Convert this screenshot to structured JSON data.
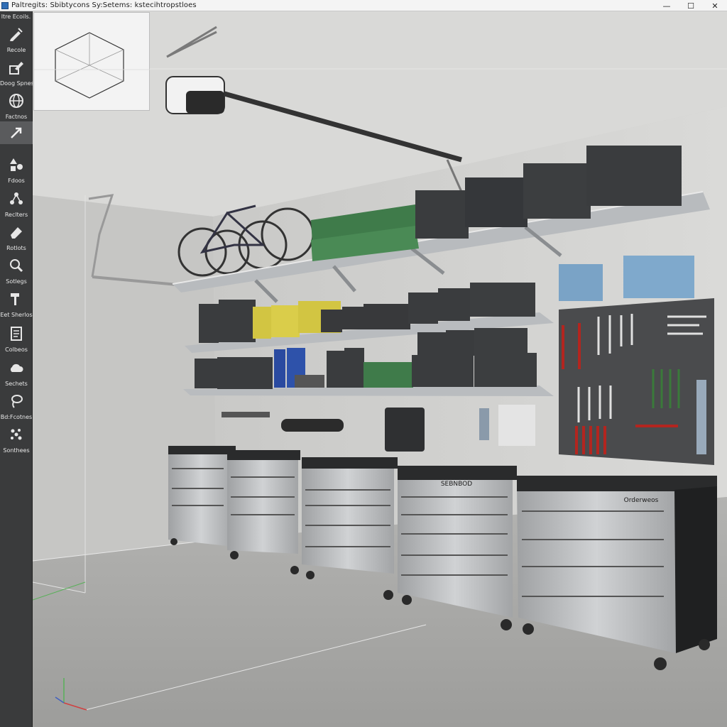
{
  "window": {
    "title": "Paltregits: Sbibtycons Sy:Setems: kstecihtropstloes",
    "minimize_glyph": "—",
    "maximize_glyph": "☐",
    "close_glyph": "✕"
  },
  "toolbar": {
    "header": "ltre Ecoils.",
    "tools": [
      {
        "label": "Recole",
        "icon": "pencil-ruler-icon"
      },
      {
        "label": "Doog Spnes",
        "icon": "pencil-box-icon"
      },
      {
        "label": "Factnos",
        "icon": "globe-icon"
      },
      {
        "label": "",
        "icon": "arrow-icon"
      },
      {
        "label": "Fdoos",
        "icon": "shapes-icon"
      },
      {
        "label": "Reclters",
        "icon": "nodes-icon"
      },
      {
        "label": "Rotlots",
        "icon": "eraser-icon"
      },
      {
        "label": "Sotlegs",
        "icon": "magnifier-icon"
      },
      {
        "label": "Eet Sherlos",
        "icon": "hammer-icon"
      },
      {
        "label": "Colbeos",
        "icon": "document-icon"
      },
      {
        "label": "Sechets",
        "icon": "cloud-icon"
      },
      {
        "label": "Bd:Fcotnes",
        "icon": "lasso-icon"
      },
      {
        "label": "Sonthees",
        "icon": "particles-icon"
      }
    ]
  },
  "scene": {
    "cabinet_brand_1": "SEBNBOD",
    "cabinet_brand_2": "Orderweos",
    "colors": {
      "wall": "#d2d2cf",
      "ceiling": "#dcdcda",
      "floor": "#a7a7a5",
      "shelf": "#b9bcbf",
      "bin_dark": "#3a3c3e",
      "bin_green": "#3f7b4a",
      "bin_yellow": "#d2c542",
      "pegboard": "#4a4b4d",
      "cabinet_steel": "#b8babc",
      "cabinet_top": "#2a2b2c",
      "panel_bg": "#3a3b3c",
      "accent_red": "#b3251f"
    }
  }
}
